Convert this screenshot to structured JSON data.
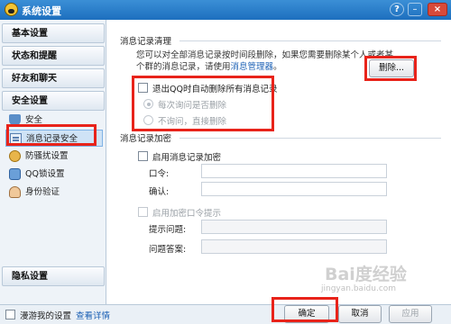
{
  "window": {
    "title": "系统设置"
  },
  "sidebar": {
    "categories": [
      "基本设置",
      "状态和提醒",
      "好友和聊天",
      "安全设置",
      "隐私设置"
    ],
    "security_items": [
      "安全",
      "消息记录安全",
      "防骚扰设置",
      "QQ锁设置",
      "身份验证"
    ]
  },
  "cleanup": {
    "title": "消息记录清理",
    "desc_before": "您可以对全部消息记录按时间段删除，如果您需要删除某个人或者某个群的消息记录，请使用",
    "desc_link": "消息管理器",
    "desc_after": "。",
    "delete_button": "删除...",
    "auto_delete_label": "退出QQ时自动删除所有消息记录",
    "option_ask": "每次询问是否删除",
    "option_direct": "不询问，直接删除"
  },
  "encrypt": {
    "title": "消息记录加密",
    "enable_label": "启用消息记录加密",
    "password_label": "口令:",
    "confirm_label": "确认:",
    "hint_enable_label": "启用加密口令提示",
    "question_label": "提示问题:",
    "answer_label": "问题答案:"
  },
  "footer": {
    "roaming_label": "漫游我的设置",
    "details_link": "查看详情",
    "ok": "确定",
    "cancel": "取消",
    "apply": "应用"
  },
  "watermark": {
    "main": "Bai度经验",
    "sub": "jingyan.baidu.com"
  },
  "colors": {
    "titlebar": "#1d6fbe",
    "highlight": "#e8231a",
    "link": "#1a5fb4"
  }
}
